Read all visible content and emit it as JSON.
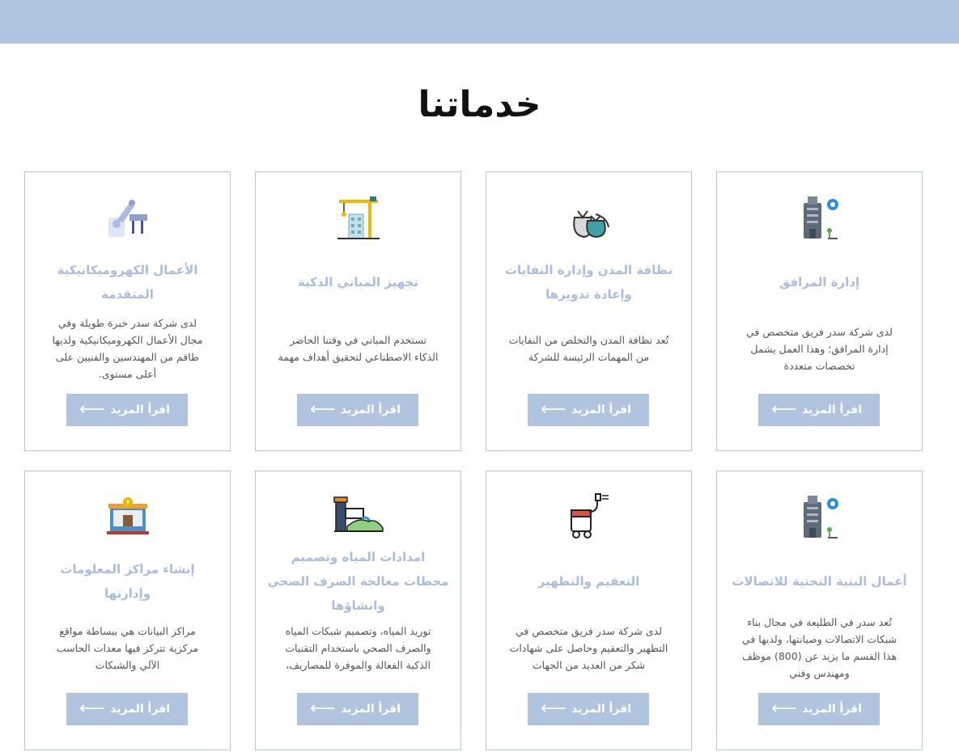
{
  "page": {
    "heading": "خدماتنا"
  },
  "cards": [
    {
      "icon": "building-gear-icon",
      "title": "إدارة المرافق",
      "desc": "لدى شركة سدر فريق متخصص في إدارة المرافق؛ وهذا العمل يشمل تخصصات متعددة",
      "button": "اقرأ المزيد"
    },
    {
      "icon": "garbage-bags-icon",
      "title": "نظافة المدن وإدارة النفايات وإعادة تدويرها",
      "desc": "تُعد نظافة المدن والتخلص من النفايات من المهمات الرئيسة للشركة",
      "button": "اقرأ المزيد"
    },
    {
      "icon": "construction-crane-icon",
      "title": "تجهيز المباني الذكية",
      "desc": "تستخدم المباني في وقتنا الحاضر الذكاء الاصطناعي لتحقيق أهداف مهمة",
      "button": "اقرأ المزيد"
    },
    {
      "icon": "robotic-arm-icon",
      "title": "الأعمال الكهروميكانيكية المتقدمة",
      "desc": "لدى شركة سدر خبرة طويلة وفي مجال الأعمال الكهروميكانيكية ولديها طاقم من المهندسين والفنيين على أعلى مستوى.",
      "button": "اقرأ المزيد"
    },
    {
      "icon": "building-gear-icon",
      "title": "أعمال البنية التحتية للاتصالات",
      "desc": "تُعد سدر في الطليعة في مجال بناء شبكات الاتصالات وصيانتها، ولديها في هذا القسم ما يزيد عن (800) موظف ومهندس وفني",
      "button": "اقرأ المزيد"
    },
    {
      "icon": "pressure-sprayer-icon",
      "title": "التعقيم والتطهير",
      "desc": "لدى شركة سدر فريق متخصص في التطهير والتعقيم وحاصل على شهادات شكر من العديد من الجهات",
      "button": "اقرأ المزيد"
    },
    {
      "icon": "sewage-pipe-icon",
      "title": "امدادات المياه وتصميم محطات معالجة الصرف الصحي وانشاؤها",
      "desc": "توريد المياه، وتصميم شبكات المياه والصرف الصحي باستخدام التقنيات الذكية الفعالة والموفرة للمصاريف،",
      "button": "اقرأ المزيد"
    },
    {
      "icon": "data-center-icon",
      "title": "إنشاء مراكز المعلومات وإدارتها",
      "desc": "مراكز البيانات هي ببساطة مواقع مركزية تتركز فيها معدات الحاسب الآلي والشبكات",
      "button": "اقرأ المزيد"
    }
  ],
  "colors": {
    "accent": "#b0c3df",
    "title": "#a9bde0",
    "border": "#b6c7dd"
  }
}
